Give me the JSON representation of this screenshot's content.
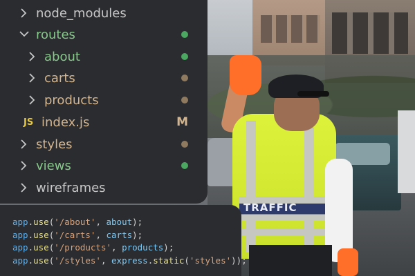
{
  "colors": {
    "folder_normal": "#c8c8c8",
    "folder_green": "#86c98a",
    "folder_tan": "#d3b58f",
    "dot_green": "#4aa860",
    "dot_tan": "#8f7a5f",
    "badge_modified": "#d3b58f"
  },
  "explorer": {
    "items": [
      {
        "label": "node_modules",
        "icon": "chevron-right-icon",
        "level": 0,
        "color": "folder_normal",
        "status": ""
      },
      {
        "label": "routes",
        "icon": "chevron-down-icon",
        "level": 0,
        "color": "folder_green",
        "status": "dot-green"
      },
      {
        "label": "about",
        "icon": "chevron-right-icon",
        "level": 1,
        "color": "folder_green",
        "status": "dot-green"
      },
      {
        "label": "carts",
        "icon": "chevron-right-icon",
        "level": 1,
        "color": "folder_tan",
        "status": "dot-tan"
      },
      {
        "label": "products",
        "icon": "chevron-right-icon",
        "level": 1,
        "color": "folder_tan",
        "status": "dot-tan"
      },
      {
        "label": "index.js",
        "icon": "js-file-icon",
        "icon_text": "JS",
        "level": 1,
        "color": "folder_tan",
        "status": "M"
      },
      {
        "label": "styles",
        "icon": "chevron-right-icon",
        "level": 0,
        "color": "folder_tan",
        "status": "dot-tan"
      },
      {
        "label": "views",
        "icon": "chevron-right-icon",
        "level": 0,
        "color": "folder_green",
        "status": "dot-green"
      },
      {
        "label": "wireframes",
        "icon": "chevron-right-icon",
        "level": 0,
        "color": "folder_normal",
        "status": ""
      }
    ]
  },
  "code": {
    "lines": [
      {
        "obj": "app",
        "fn": "use",
        "path": "'/about'",
        "handler": "about"
      },
      {
        "obj": "app",
        "fn": "use",
        "path": "'/carts'",
        "handler": "carts"
      },
      {
        "obj": "app",
        "fn": "use",
        "path": "'/products'",
        "handler": "products"
      },
      {
        "obj": "app",
        "fn": "use",
        "path": "'/styles'",
        "handler": "express.static('styles')"
      }
    ]
  },
  "photo": {
    "vest_text": "TRAFFIC"
  }
}
